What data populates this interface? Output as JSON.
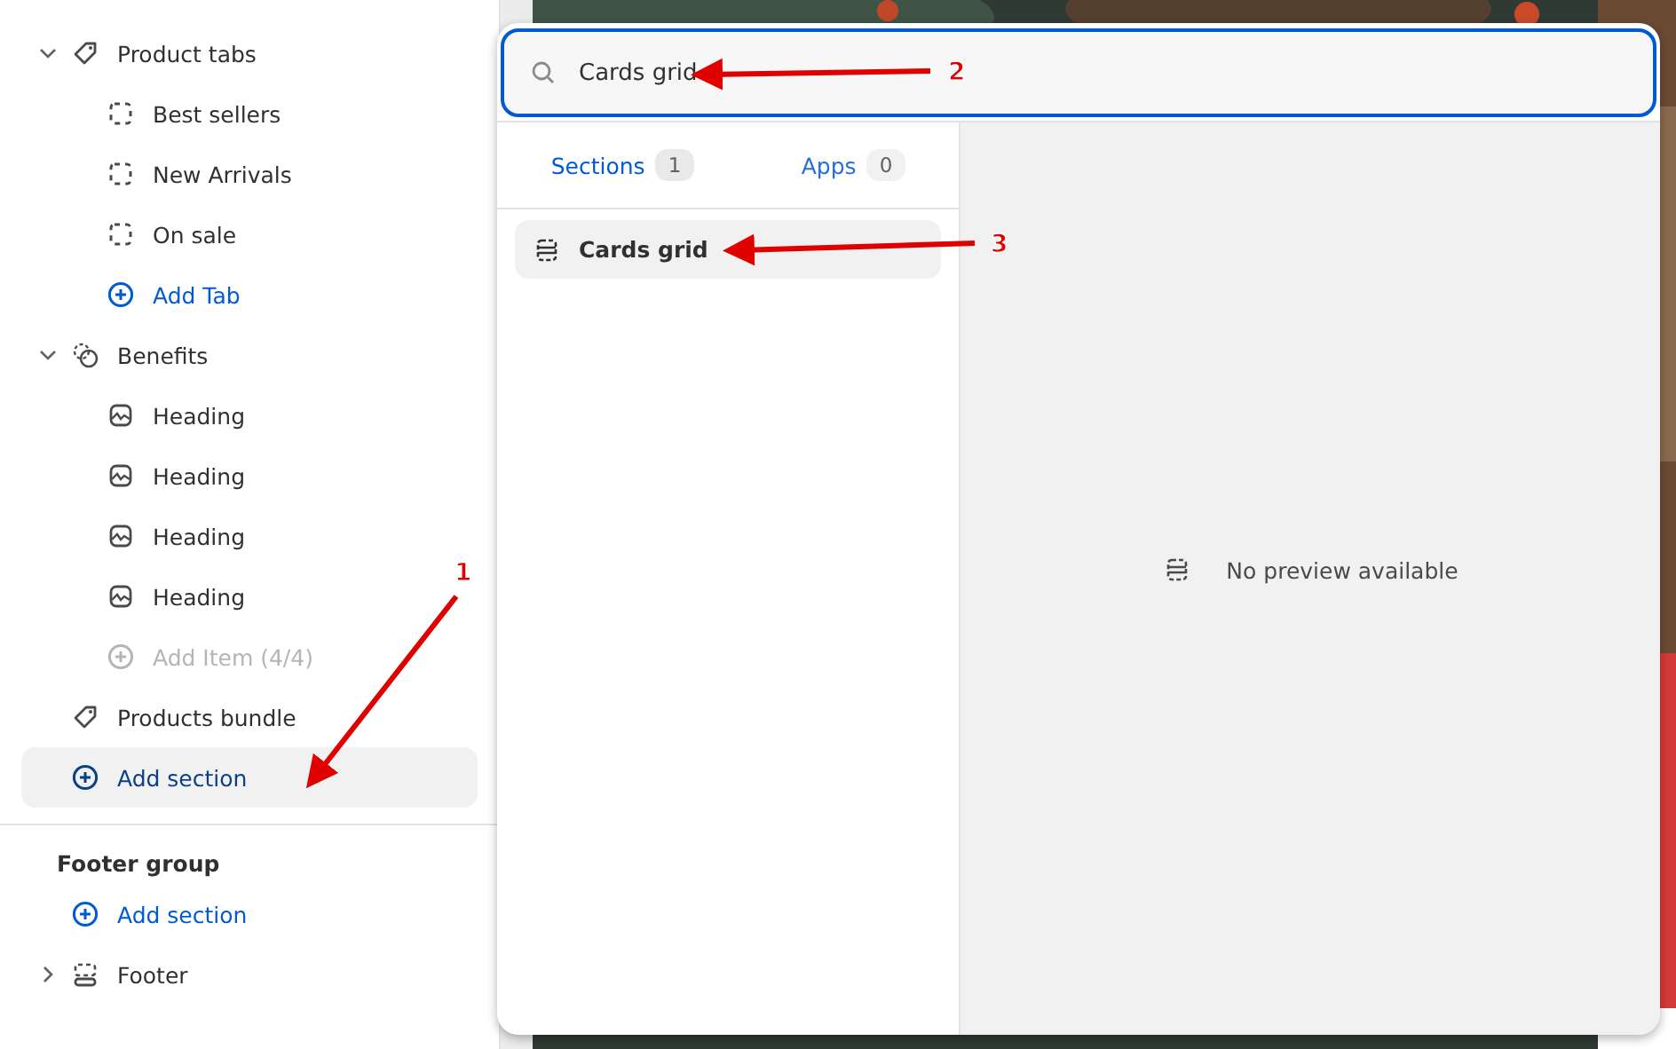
{
  "sidebar": {
    "items": [
      {
        "label": "Product tabs",
        "kind": "group",
        "expanded": true,
        "children": [
          {
            "label": "Best sellers",
            "kind": "item"
          },
          {
            "label": "New Arrivals",
            "kind": "item"
          },
          {
            "label": "On sale",
            "kind": "item"
          },
          {
            "label": "Add Tab",
            "kind": "add",
            "disabled": false
          }
        ]
      },
      {
        "label": "Benefits",
        "kind": "group",
        "expanded": true,
        "children": [
          {
            "label": "Heading",
            "kind": "item"
          },
          {
            "label": "Heading",
            "kind": "item"
          },
          {
            "label": "Heading",
            "kind": "item"
          },
          {
            "label": "Heading",
            "kind": "item"
          },
          {
            "label": "Add Item (4/4)",
            "kind": "add",
            "disabled": true
          }
        ]
      },
      {
        "label": "Products bundle",
        "kind": "item"
      },
      {
        "label": "Add section",
        "kind": "add",
        "disabled": false,
        "selected": true
      }
    ],
    "footer_group": {
      "title": "Footer group",
      "items": [
        {
          "label": "Add section",
          "kind": "add",
          "disabled": false,
          "selected": false
        },
        {
          "label": "Footer",
          "kind": "group",
          "expanded": false
        }
      ]
    }
  },
  "popup": {
    "search": {
      "value": "Cards grid"
    },
    "tabs": [
      {
        "label": "Sections",
        "count": "1",
        "selected": true
      },
      {
        "label": "Apps",
        "count": "0",
        "selected": false
      }
    ],
    "results": [
      {
        "label": "Cards grid",
        "selected": true
      }
    ],
    "preview": {
      "text": "No preview available"
    }
  },
  "annotations": [
    {
      "number": "1"
    },
    {
      "number": "2"
    },
    {
      "number": "3"
    }
  ]
}
